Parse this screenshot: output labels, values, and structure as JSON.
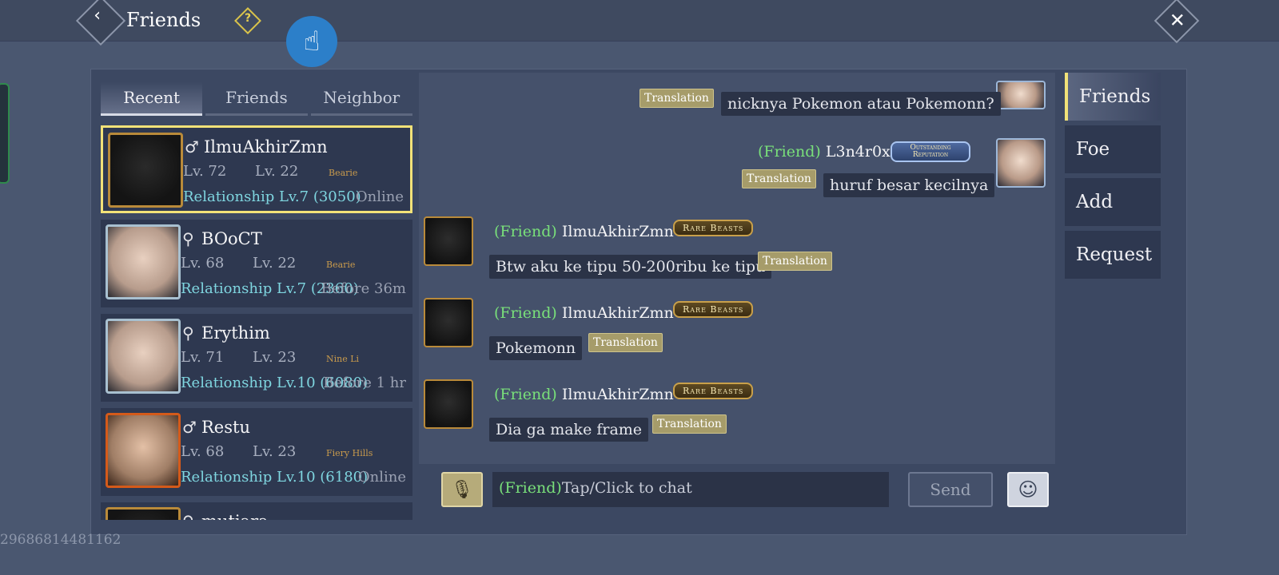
{
  "header": {
    "title": "Friends",
    "help_label": "?"
  },
  "list_tabs": [
    "Recent",
    "Friends",
    "Neighbor"
  ],
  "friends": [
    {
      "gender": "♂",
      "name": "IlmuAkhirZmn",
      "lv": "Lv. 72",
      "guild_lv": "Lv. 22",
      "tag": "Bearie",
      "relationship": "Relationship Lv.7 (3050)",
      "status": "Online"
    },
    {
      "gender": "⚲",
      "name": "BOoCT",
      "lv": "Lv. 68",
      "guild_lv": "Lv. 22",
      "tag": "Bearie",
      "relationship": "Relationship Lv.7 (2360)",
      "status": "Before 36m"
    },
    {
      "gender": "⚲",
      "name": "Erythim",
      "lv": "Lv. 71",
      "guild_lv": "Lv. 23",
      "tag": "Nine Li",
      "relationship": "Relationship Lv.10 (6080)",
      "status": "Before 1 hr"
    },
    {
      "gender": "♂",
      "name": "Restu",
      "lv": "Lv. 68",
      "guild_lv": "Lv. 23",
      "tag": "Fiery Hills",
      "relationship": "Relationship Lv.10 (6180)",
      "status": "Online"
    },
    {
      "gender": "⚲",
      "name": "mutiara",
      "lv": "",
      "guild_lv": "",
      "tag": "",
      "relationship": "",
      "status": ""
    }
  ],
  "chat": {
    "translation_label": "Translation",
    "relation_prefix": "(Friend)",
    "messages": [
      {
        "text": "nicknya Pokemon atau Pokemonn?"
      },
      {
        "sender": "L3n4r0x",
        "badge": "Outstanding Reputation",
        "text": "huruf besar kecilnya"
      },
      {
        "sender": "IlmuAkhirZmn",
        "badge": "Rare Beasts",
        "text": "Btw aku ke tipu 50-200ribu ke tipu"
      },
      {
        "sender": "IlmuAkhirZmn",
        "badge": "Rare Beasts",
        "text": "Pokemonn"
      },
      {
        "sender": "IlmuAkhirZmn",
        "badge": "Rare Beasts",
        "text": "Dia ga make frame"
      }
    ]
  },
  "input": {
    "prefix": "(Friend)",
    "placeholder": "Tap/Click to chat",
    "send_label": "Send"
  },
  "side_tabs": [
    "Friends",
    "Foe",
    "Add",
    "Request"
  ],
  "footer_id": "29686814481162",
  "colors": {
    "highlight": "#f2e278",
    "relation_green": "#79e07a",
    "relationship_cyan": "#7fd6e0"
  }
}
